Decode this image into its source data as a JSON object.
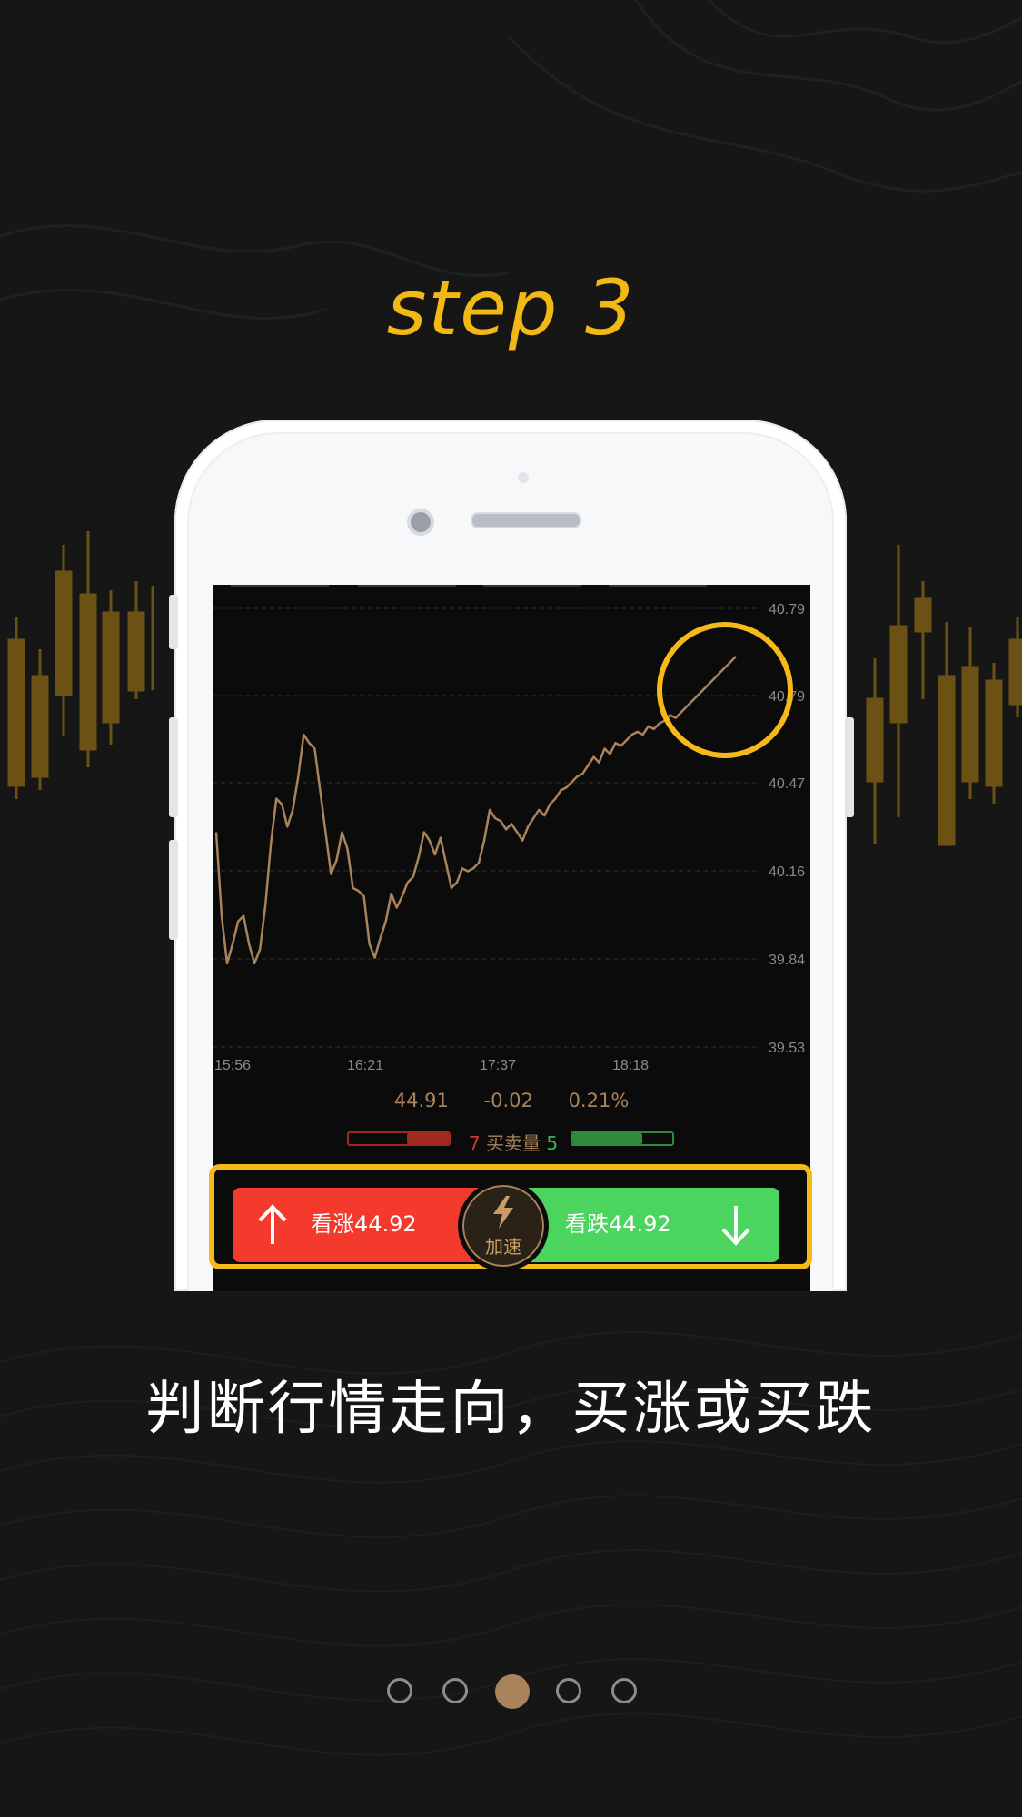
{
  "header": {
    "step_title": "step 3"
  },
  "chart_data": {
    "type": "line",
    "y_ticks": [
      "40.79",
      "40.79",
      "40.47",
      "40.16",
      "39.84",
      "39.53"
    ],
    "x_ticks": [
      "15:56",
      "16:21",
      "17:37",
      "18:18"
    ],
    "ylim": [
      39.53,
      40.95
    ],
    "x": [
      0,
      1,
      2,
      3,
      4,
      5,
      6,
      7,
      8,
      9,
      10,
      11,
      12,
      13,
      14,
      15,
      16,
      17,
      18,
      19,
      20,
      21,
      22,
      23,
      24,
      25,
      26,
      27,
      28,
      29,
      30,
      31,
      32,
      33,
      34,
      35,
      36,
      37,
      38,
      39,
      40,
      41,
      42,
      43,
      44,
      45,
      46,
      47,
      48,
      49,
      50,
      51,
      52,
      53,
      54,
      55,
      56,
      57,
      58,
      59,
      60,
      61,
      62,
      63,
      64,
      65,
      66,
      67,
      68,
      69,
      70,
      71,
      72,
      73,
      74,
      75,
      76,
      77,
      78,
      79,
      80,
      81,
      82,
      83,
      84,
      85,
      86,
      87,
      88,
      89,
      90,
      91,
      92,
      93,
      94,
      95,
      96,
      97,
      98,
      99,
      100,
      101,
      102,
      103,
      104,
      105,
      106,
      107,
      108,
      109,
      110,
      111,
      112,
      113,
      114,
      115,
      116,
      117,
      118,
      119,
      120,
      121,
      122,
      123,
      124,
      125,
      126,
      127,
      128,
      129,
      130,
      131,
      132,
      133,
      134,
      135,
      136,
      137,
      138,
      139,
      140,
      141,
      142,
      143,
      144,
      145,
      146,
      147,
      148,
      149,
      150,
      151,
      152,
      153,
      154,
      155,
      156,
      157,
      158,
      159,
      160,
      161,
      162,
      163,
      164
    ],
    "values": [
      40.3,
      40.0,
      39.83,
      39.9,
      39.98,
      40.0,
      39.9,
      39.83,
      39.88,
      40.04,
      40.26,
      40.42,
      40.4,
      40.32,
      40.38,
      40.5,
      40.65,
      40.62,
      40.6,
      40.45,
      40.3,
      40.15,
      40.2,
      40.3,
      40.24,
      40.1,
      40.09,
      40.07,
      39.9,
      39.85,
      39.92,
      39.98,
      40.08,
      40.03,
      40.07,
      40.12,
      40.14,
      40.21,
      40.3,
      40.27,
      40.22,
      40.28,
      40.19,
      40.1,
      40.12,
      40.17,
      40.16,
      40.17,
      40.19,
      40.27,
      40.38,
      40.35,
      40.34,
      40.31,
      40.33,
      40.3,
      40.27,
      40.32,
      40.35,
      40.38,
      40.36,
      40.4,
      40.42,
      40.45,
      40.46,
      40.48,
      40.5,
      40.51,
      40.54,
      40.57,
      40.55,
      40.6,
      40.58,
      40.62,
      40.61,
      40.63,
      40.65,
      40.66,
      40.65,
      40.68,
      40.67,
      40.69,
      40.7,
      40.72,
      40.71,
      40.73,
      40.75,
      40.77,
      40.79,
      40.81,
      40.83,
      40.85,
      40.87,
      40.89,
      40.91,
      40.93
    ],
    "highlight": "circle around latest price"
  },
  "quote": {
    "price": "44.91",
    "change": "-0.02",
    "percent": "0.21%"
  },
  "volume": {
    "buy_count": "7",
    "label": "买卖量",
    "sell_count": "5",
    "buy_ratio": 0.42,
    "sell_ratio": 0.7
  },
  "trade": {
    "up_label": "看涨44.92",
    "down_label": "看跌44.92",
    "accelerate_label": "加速"
  },
  "slogan": "判断行情走向，买涨或买跌",
  "pagination": {
    "total": 5,
    "active_index": 2
  },
  "colors": {
    "accent": "#f2b814",
    "up": "#f33a2c",
    "down": "#4bd45e",
    "line": "#a9835a"
  }
}
